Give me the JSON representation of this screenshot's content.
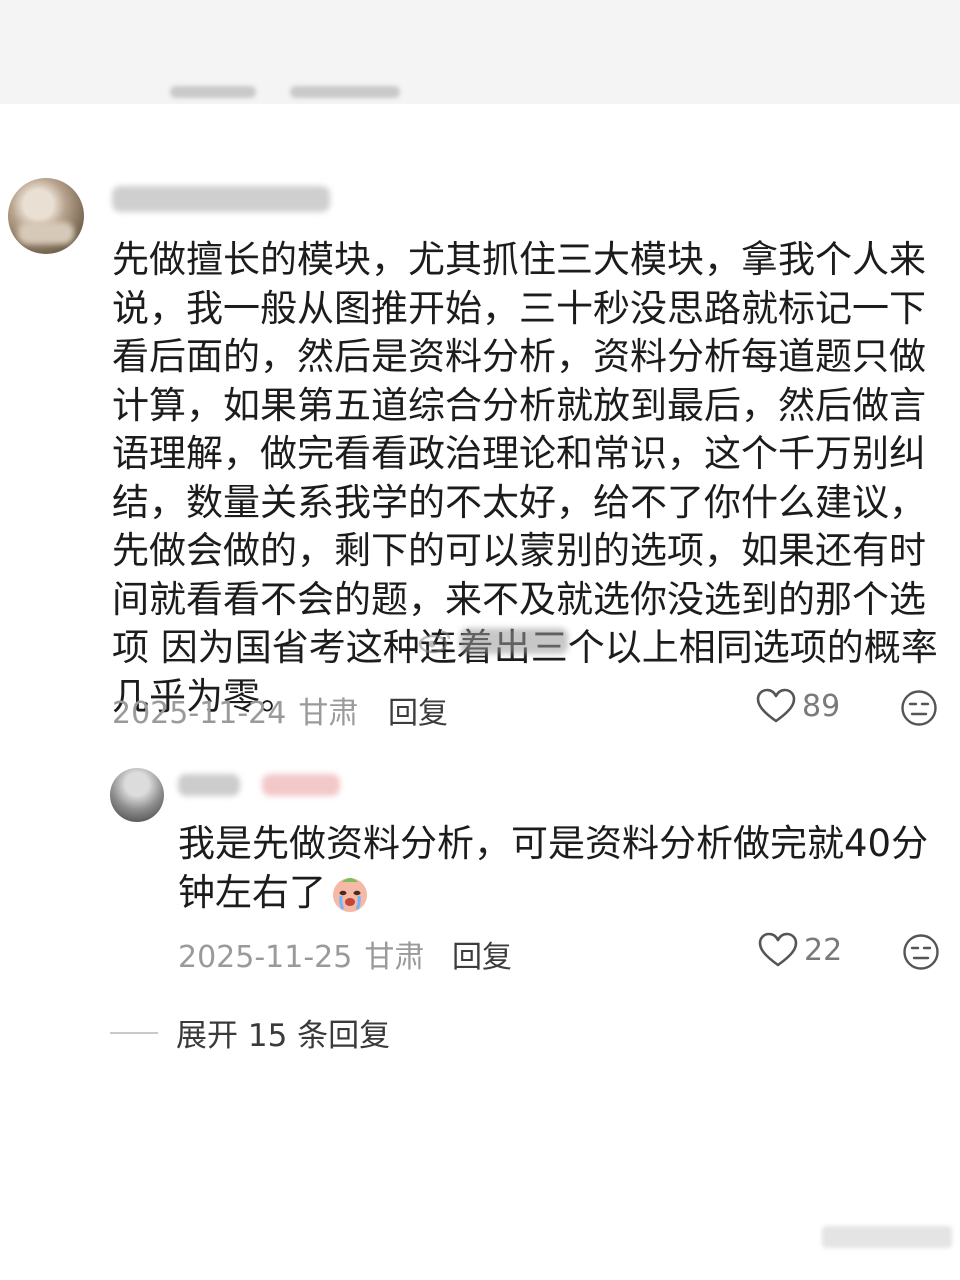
{
  "comment": {
    "text": "先做擅长的模块，尤其抓住三大模块，拿我个人来说，我一般从图推开始，三十秒没思路就标记一下看后面的，然后是资料分析，资料分析每道题只做计算，如果第五道综合分析就放到最后，然后做言语理解，做完看看政治理论和常识，这个千万别纠结，数量关系我学的不太好，给不了你什么建议，先做会做的，剩下的可以蒙别的选项，如果还有时间就看看不会的题，来不及就选你没选到的那个选项 因为国省考这种连着出三个以上相同选项的概率几乎为零。",
    "date": "2025-11-24",
    "location": "甘肃",
    "reply_label": "回复",
    "likes": "89"
  },
  "reply": {
    "text": "我是先做资料分析，可是资料分析做完就40分钟左右了",
    "emoji": "crying-face-emoji",
    "date": "2025-11-25",
    "location": "甘肃",
    "reply_label": "回复",
    "likes": "22"
  },
  "expand_label": "展开 15 条回复",
  "icons": {
    "like": "heart-icon",
    "dislike": "unamused-face-icon"
  },
  "colors": {
    "text": "#1c1c1c",
    "meta": "#9a9a9a",
    "action": "#3d3d3d"
  }
}
